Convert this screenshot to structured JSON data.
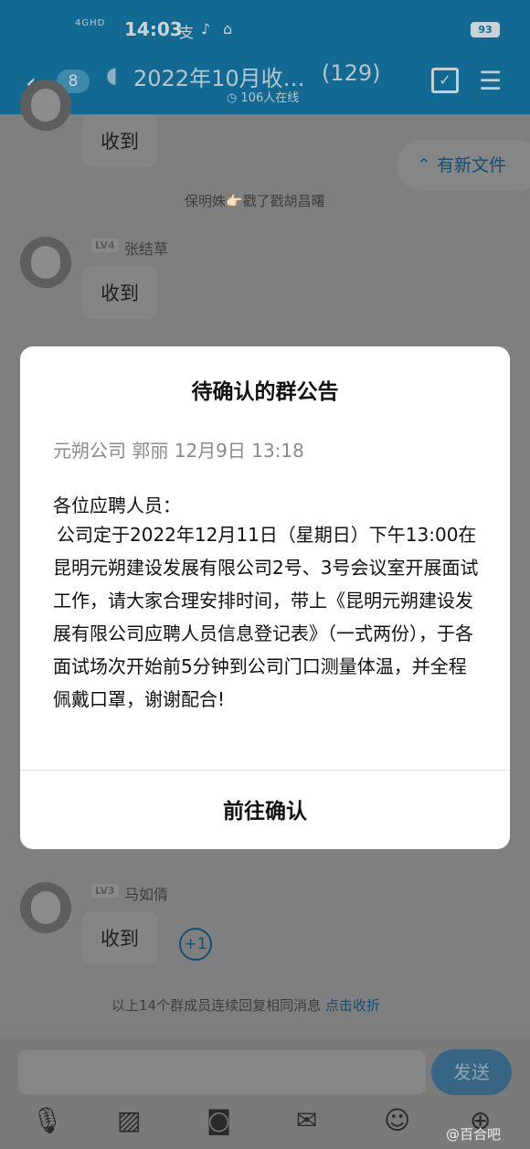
{
  "status": {
    "network": "4GHD",
    "time": "14:03",
    "battery": "93"
  },
  "header": {
    "unread_count": "8",
    "title": "2022年10月收…",
    "member_count": "(129)",
    "online": "106人在线"
  },
  "chat": {
    "new_files": "有新文件",
    "messages": [
      {
        "text": "收到"
      },
      {
        "system": "保明姝👉🏻戳了戳胡昌曙"
      },
      {
        "level": "LV4",
        "user": "张结草",
        "text": "收到"
      },
      {
        "level": "LV3",
        "user": "马如倩",
        "text": "收到"
      }
    ],
    "plus_one": "+1",
    "collapse_text": "以上14个群成员连续回复相同消息",
    "collapse_link": "点击收折"
  },
  "modal": {
    "title": "待确认的群公告",
    "meta": "元朔公司 郭丽 12月9日 13:18",
    "greeting": "各位应聘人员：",
    "body": "公司定于2022年12月11日（星期日）下午13:00在昆明元朔建设发展有限公司2号、3号会议室开展面试工作，请大家合理安排时间，带上《昆明元朔建设发展有限公司应聘人员信息登记表》（一式两份），于各面试场次开始前5分钟到公司门口测量体温，并全程佩戴口罩，谢谢配合!",
    "confirm_label": "前往确认"
  },
  "input": {
    "send_label": "发送"
  },
  "tools": [
    "microphone-icon",
    "image-icon",
    "camera-icon",
    "file-icon",
    "emoji-icon",
    "plus-icon"
  ],
  "watermark": "@百合吧"
}
